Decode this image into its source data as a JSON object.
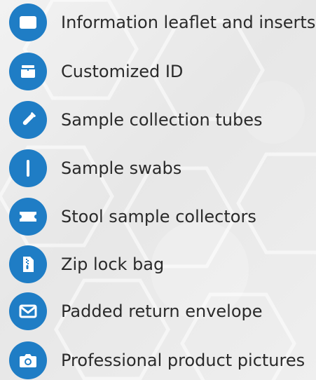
{
  "items": [
    {
      "label": "Information leaflet and inserts",
      "icon": "leaflet-icon"
    },
    {
      "label": "Customized ID",
      "icon": "id-box-icon"
    },
    {
      "label": "Sample collection tubes",
      "icon": "test-tube-icon"
    },
    {
      "label": "Sample swabs",
      "icon": "swab-icon"
    },
    {
      "label": "Stool sample collectors",
      "icon": "stool-collector-icon"
    },
    {
      "label": "Zip lock bag",
      "icon": "zip-bag-icon"
    },
    {
      "label": "Padded return envelope",
      "icon": "envelope-icon"
    },
    {
      "label": "Professional product pictures",
      "icon": "camera-icon"
    }
  ],
  "colors": {
    "icon_bg": "#1f7dc5",
    "text": "#2a2a2a",
    "page_bg": "#ececec"
  }
}
